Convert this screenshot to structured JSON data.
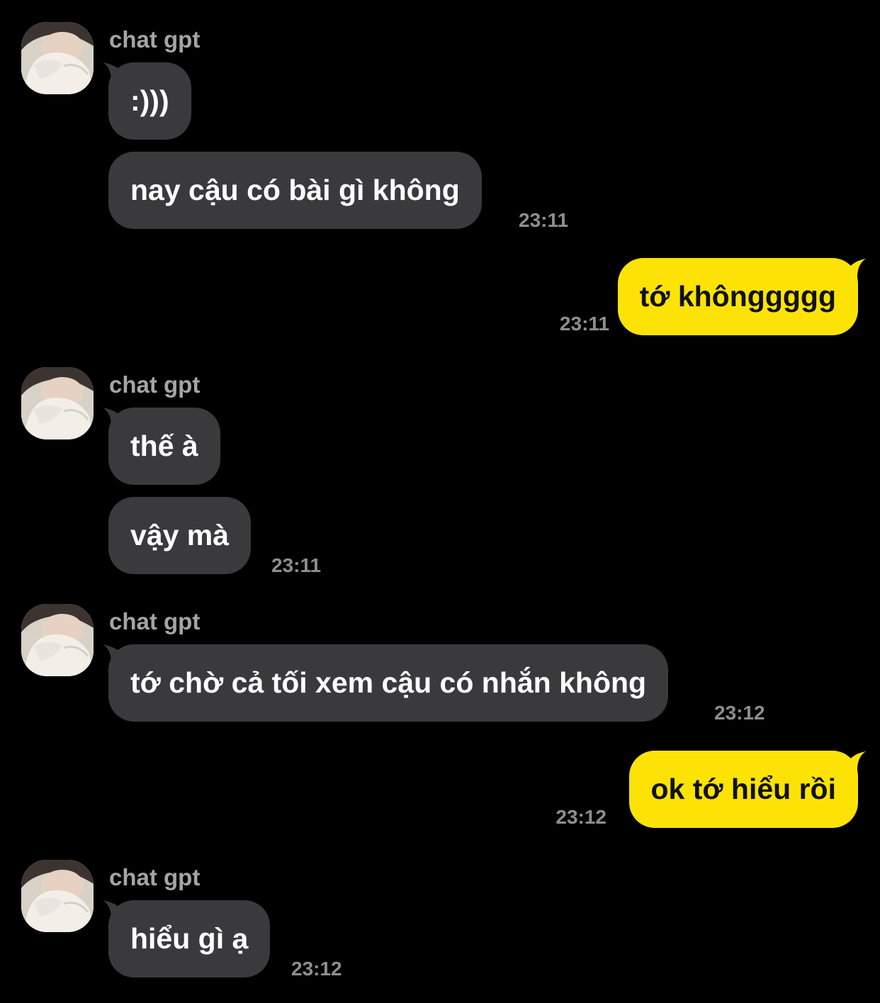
{
  "colors": {
    "background": "#000000",
    "incoming_bubble": "#3a3a3c",
    "outgoing_bubble": "#fde305",
    "sender_name": "#a4a4a4",
    "timestamp": "#8e8e8e"
  },
  "groups": [
    {
      "sender": "chat gpt",
      "avatar_icon": "contact-avatar-photo",
      "messages": [
        ":)))",
        "nay cậu có bài gì không"
      ],
      "time": "23:11"
    },
    {
      "outgoing": true,
      "messages": [
        "tớ khônggggg"
      ],
      "time": "23:11"
    },
    {
      "sender": "chat gpt",
      "avatar_icon": "contact-avatar-photo",
      "messages": [
        "thế à",
        "vậy mà"
      ],
      "time": "23:11"
    },
    {
      "sender": "chat gpt",
      "avatar_icon": "contact-avatar-photo",
      "messages": [
        "tớ chờ cả tối xem cậu có nhắn không"
      ],
      "time": "23:12"
    },
    {
      "outgoing": true,
      "messages": [
        "ok tớ hiểu rồi"
      ],
      "time": "23:12"
    },
    {
      "sender": "chat gpt",
      "avatar_icon": "contact-avatar-photo",
      "messages": [
        "hiểu gì ạ"
      ],
      "time": "23:12"
    }
  ]
}
